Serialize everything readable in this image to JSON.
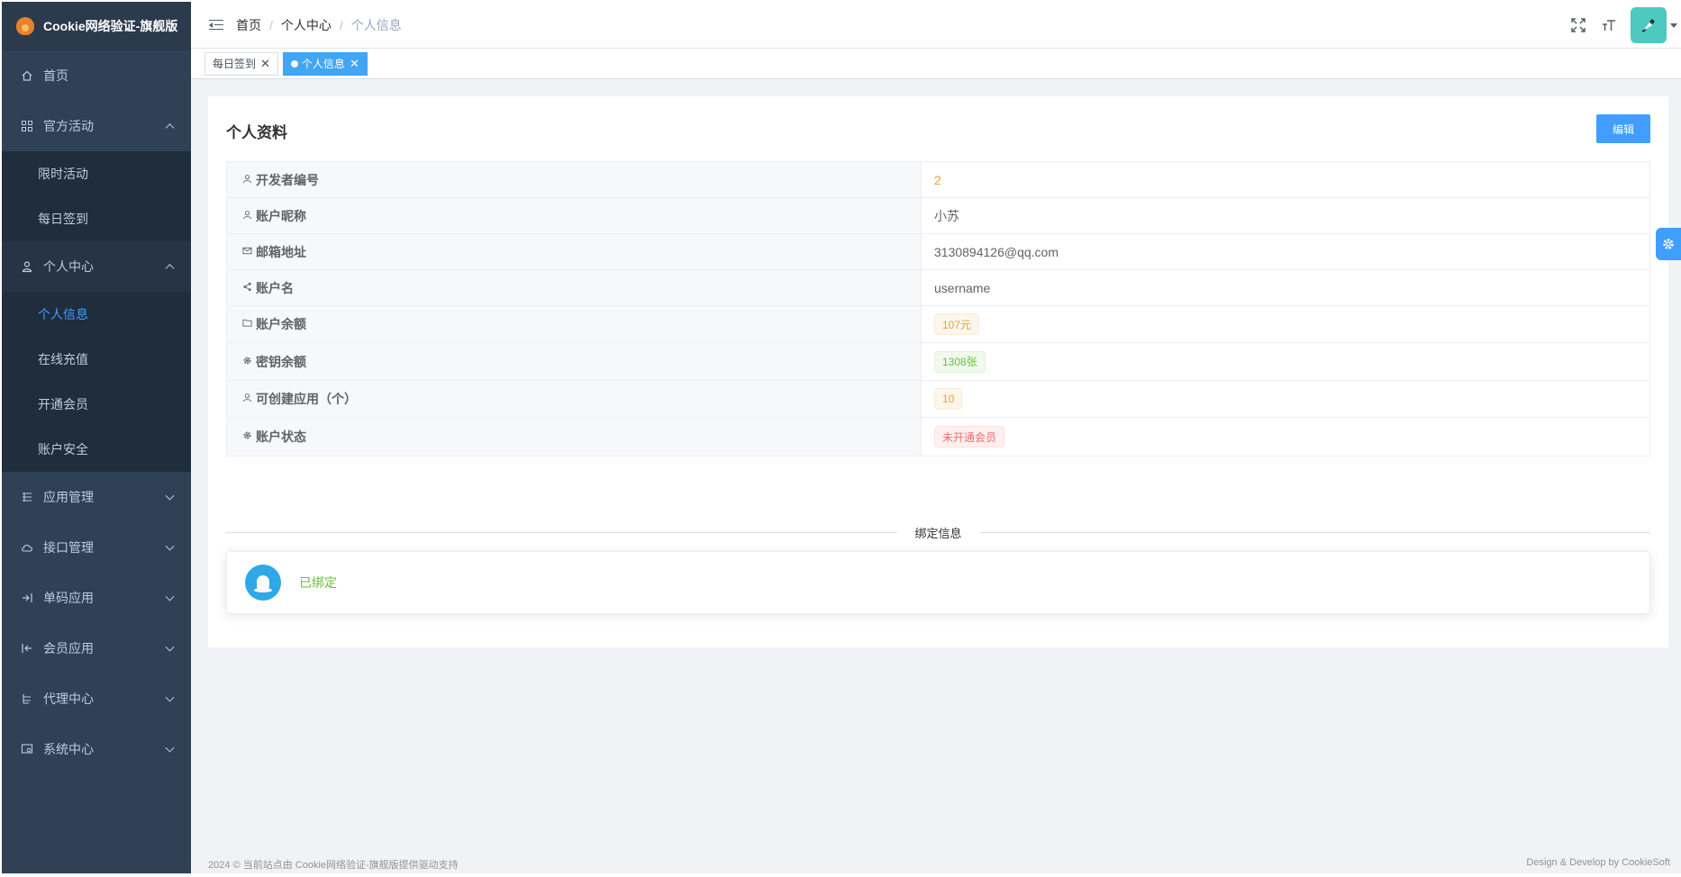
{
  "app": {
    "title": "Cookie网络验证-旗舰版"
  },
  "sidebar": {
    "items": [
      {
        "label": "首页",
        "icon": "home-icon"
      },
      {
        "label": "官方活动",
        "icon": "grid-icon",
        "expanded": true,
        "children": [
          {
            "label": "限时活动"
          },
          {
            "label": "每日签到"
          }
        ]
      },
      {
        "label": "个人中心",
        "icon": "user-icon",
        "expanded": true,
        "children": [
          {
            "label": "个人信息",
            "active": true
          },
          {
            "label": "在线充值"
          },
          {
            "label": "开通会员"
          },
          {
            "label": "账户安全"
          }
        ]
      },
      {
        "label": "应用管理",
        "icon": "list-icon"
      },
      {
        "label": "接口管理",
        "icon": "cloud-icon"
      },
      {
        "label": "单码应用",
        "icon": "login-arrow-icon"
      },
      {
        "label": "会员应用",
        "icon": "logout-arrow-icon"
      },
      {
        "label": "代理中心",
        "icon": "tree-icon"
      },
      {
        "label": "系统中心",
        "icon": "monitor-icon"
      }
    ]
  },
  "header": {
    "breadcrumb": [
      "首页",
      "个人中心",
      "个人信息"
    ],
    "separator": "/"
  },
  "tags": [
    {
      "label": "每日签到",
      "active": false
    },
    {
      "label": "个人信息",
      "active": true
    }
  ],
  "profile": {
    "title": "个人资料",
    "edit_label": "编辑",
    "rows": [
      {
        "label": "开发者编号",
        "value": "2",
        "icon": "user-icon",
        "style": "orange"
      },
      {
        "label": "账户昵称",
        "value": "小苏",
        "icon": "user-icon",
        "style": "plain"
      },
      {
        "label": "邮箱地址",
        "value": "3130894126@qq.com",
        "icon": "mail-icon",
        "style": "plain"
      },
      {
        "label": "账户名",
        "value": "username",
        "icon": "share-icon",
        "style": "plain"
      },
      {
        "label": "账户余额",
        "value": "107元",
        "icon": "folder-icon",
        "style": "warn"
      },
      {
        "label": "密钥余额",
        "value": "1308张",
        "icon": "gear-icon",
        "style": "success"
      },
      {
        "label": "可创建应用（个）",
        "value": "10",
        "icon": "user-icon",
        "style": "warn"
      },
      {
        "label": "账户状态",
        "value": "未开通会员",
        "icon": "gear-icon",
        "style": "danger"
      }
    ]
  },
  "binding": {
    "divider_label": "绑定信息",
    "status": "已绑定",
    "icon": "qq-icon"
  },
  "footer": {
    "left": "2024 © 当前站点由 Cookie网络验证-旗舰版提供驱动支持",
    "right": "Design & Develop by CookieSoft"
  },
  "colors": {
    "sidebar_bg": "#304156",
    "accent": "#409eff",
    "success": "#67c23a",
    "warning": "#e6a23c",
    "danger": "#f56c6c"
  }
}
